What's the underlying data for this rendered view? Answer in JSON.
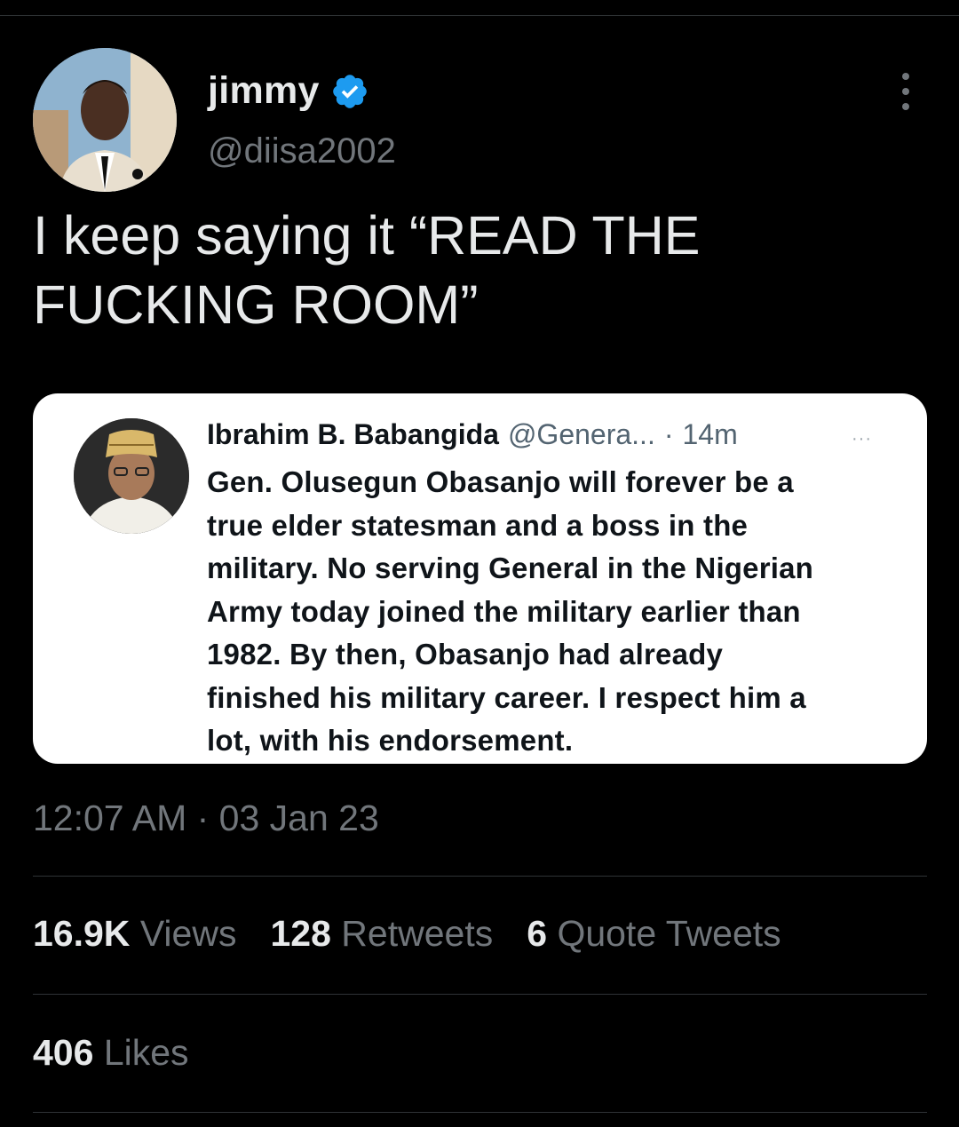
{
  "author": {
    "display_name": "jimmy",
    "handle": "@diisa2002",
    "verified_icon": "verified-badge-icon",
    "verified_color": "#1d9bf0"
  },
  "tweet": {
    "text": "I keep saying it “READ THE\nFUCKING ROOM”",
    "timestamp": "12:07 AM · 03 Jan 23"
  },
  "quoted": {
    "name": "Ibrahim B. Babangida",
    "handle": "@Genera...",
    "separator": "·",
    "time": "14m",
    "more": "···",
    "text": "Gen. Olusegun Obasanjo will forever be a\ntrue elder statesman and a boss in the\nmilitary. No serving General in the Nigerian\nArmy today joined the military earlier than\n1982. By then, Obasanjo had already\nfinished his military career. I respect him a\nlot, with his endorsement."
  },
  "stats": {
    "views_count": "16.9K",
    "views_label": "Views",
    "retweets_count": "128",
    "retweets_label": "Retweets",
    "quotes_count": "6",
    "quotes_label": "Quote Tweets",
    "likes_count": "406",
    "likes_label": "Likes"
  }
}
